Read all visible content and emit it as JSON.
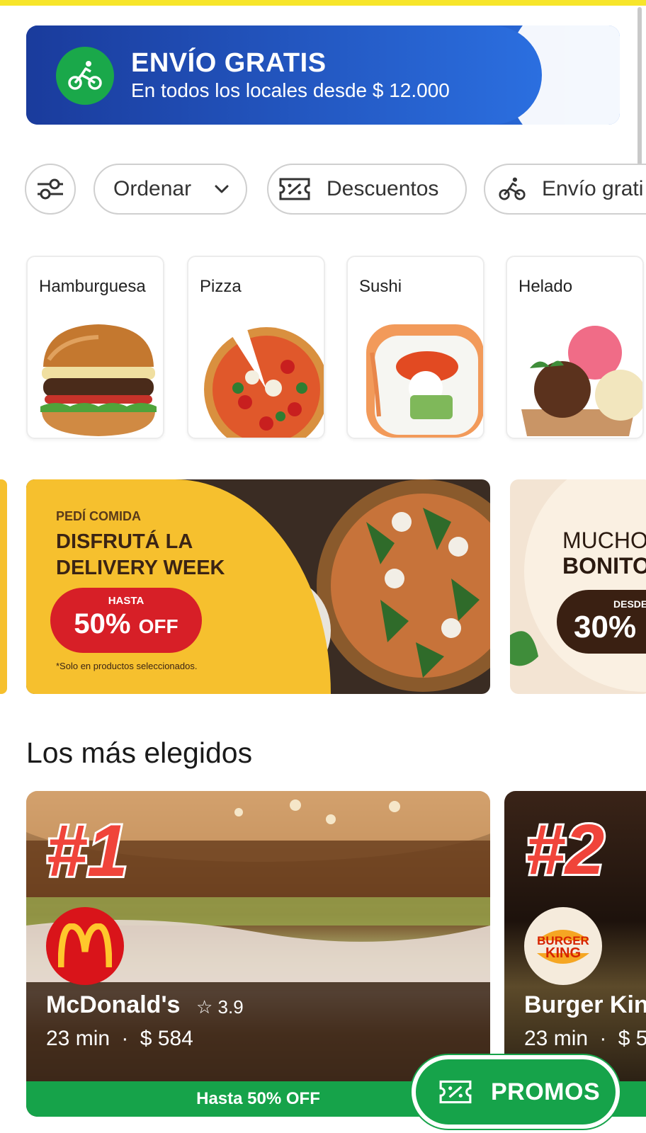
{
  "banner": {
    "title": "ENVÍO GRATIS",
    "subtitle": "En todos los locales desde $ 12.000",
    "icon": "bike-delivery-icon"
  },
  "filters": {
    "filter_icon": "sliders-icon",
    "order_label": "Ordenar",
    "discounts_label": "Descuentos",
    "free_shipping_label": "Envío grati"
  },
  "categories": [
    {
      "label": "Hamburguesa"
    },
    {
      "label": "Pizza"
    },
    {
      "label": "Sushi"
    },
    {
      "label": "Helado"
    }
  ],
  "promos": {
    "main": {
      "kicker": "PEDÍ COMIDA",
      "title_line1": "DISFRUTÁ LA",
      "title_line2": "DELIVERY WEEK",
      "pill_small": "HASTA",
      "pill_value": "50%",
      "pill_suffix": "OFF",
      "footnote": "*Solo en productos seleccionados."
    },
    "side": {
      "line1": "MUCHO",
      "line2": "BONITO",
      "pill_small": "DESDE",
      "pill_value": "30%"
    }
  },
  "section": {
    "title": "Los más elegidos"
  },
  "restaurants": [
    {
      "rank": "#1",
      "name": "McDonald's",
      "rating": "3.9",
      "time": "23 min",
      "sep": "·",
      "cost": "$ 584",
      "promo": "Hasta 50% OFF",
      "logo_text": "M"
    },
    {
      "rank": "#2",
      "name": "Burger Kin",
      "time": "23 min",
      "sep": "·",
      "cost": "$ 5",
      "logo_line1": "BURGER",
      "logo_line2": "KING"
    }
  ],
  "floating": {
    "label": "PROMOS",
    "icon": "coupon-icon"
  },
  "colors": {
    "accent_green": "#16a34a",
    "banner_blue": "#1c49b6",
    "brand_yellow": "#f7e52a",
    "rank_red": "#f0443a"
  }
}
